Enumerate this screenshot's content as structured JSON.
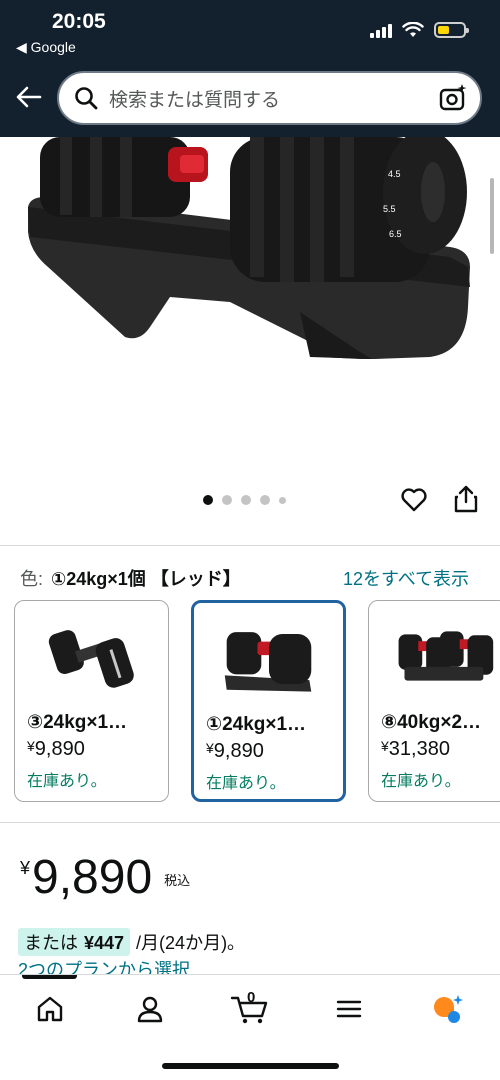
{
  "status_bar": {
    "time": "20:05",
    "back_app": "◀ Google"
  },
  "search": {
    "placeholder": "検索または質問する"
  },
  "carousel": {
    "image_alt": "adjustable dumbbell on black stand",
    "dot_count": 5,
    "active_index": 0
  },
  "variant": {
    "label": "色:",
    "selected": "①24kg×1個 【レッド】",
    "see_all": "12をすべて表示",
    "options": [
      {
        "name": "③24kg×1…",
        "price": "9,890",
        "currency": "¥",
        "stock": "在庫あり。",
        "selected": false
      },
      {
        "name": "①24kg×1…",
        "price": "9,890",
        "currency": "¥",
        "stock": "在庫あり。",
        "selected": true
      },
      {
        "name": "⑧40kg×2…",
        "price": "31,380",
        "currency": "¥",
        "stock": "在庫あり。",
        "selected": false
      }
    ]
  },
  "price": {
    "currency": "¥",
    "amount": "9,890",
    "tax_note": "税込"
  },
  "installment": {
    "prefix": "または",
    "amount": "¥447",
    "suffix": "/月(24か月)。",
    "plans_link": "2つのプランから選択"
  },
  "bottom_nav": {
    "cart_count": "0",
    "items": [
      "home-icon",
      "account-icon",
      "cart-icon",
      "menu-icon",
      "rufus-icon"
    ]
  },
  "colors": {
    "header_bg": "#13202e",
    "link": "#007185",
    "in_stock": "#067d62",
    "selected_border": "#2162a1",
    "installment_highlight": "#cdf3ec"
  }
}
